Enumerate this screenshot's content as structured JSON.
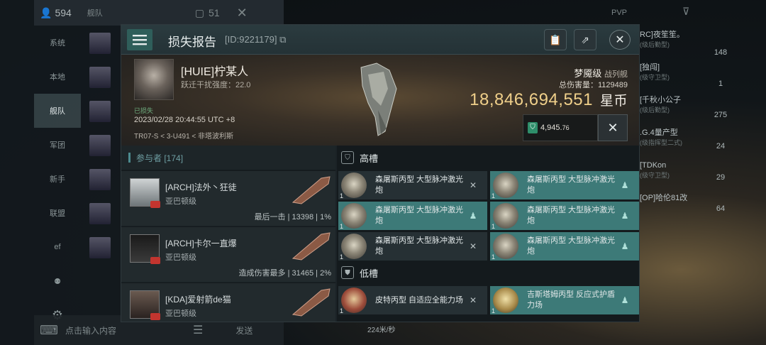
{
  "background_ui": {
    "left_top_count": "594",
    "chat_tab_label": "舰队",
    "chat_tab_count": "51",
    "side_nav": [
      "系统",
      "本地",
      "舰队",
      "军团",
      "新手",
      "联盟",
      "ef"
    ],
    "chat_placeholder": "点击输入内容",
    "send_label": "发送",
    "speed_text": "224米/秒",
    "top_right_label": "PVP",
    "right_column": [
      {
        "name": "RC]夜笙笙。",
        "sub": "(级后勤型)"
      },
      {
        "name": "[独闯]",
        "sub": "(级守卫型)"
      },
      {
        "name": "[千秋小公子",
        "sub": "(级后勤型)"
      },
      {
        "name": ".G.4量产型",
        "sub": "(级指挥型二式)"
      },
      {
        "name": "[TDKon",
        "sub": "(级守卫型)"
      },
      {
        "name": "[OP]哈伦81改",
        "sub": ""
      }
    ],
    "right_rail_counts": [
      "148",
      "1",
      "275",
      "24",
      "29",
      "64"
    ]
  },
  "header": {
    "title": "损失报告",
    "report_id": "[ID:9221179]",
    "copy_icon": "copy-icon",
    "clipboard_icon": "clipboard-icon",
    "share_icon": "share-icon",
    "close_icon": "close-icon"
  },
  "victim": {
    "name": "[HUIE]柠某人",
    "warp_disrupt": "跃迁干扰强度：22.0",
    "tag": "已损失",
    "datetime": "2023/02/28 20:44:55 UTC +8",
    "location": "TR07-S < 3-U491 < 非塔波利斯",
    "ship_name": "梦魇级",
    "ship_class": "战列舰",
    "damage_label": "总伤害量：1129489",
    "isk_value": "18,846,694,551",
    "isk_unit": "星币",
    "market_value": "4,945.",
    "market_value_decimal": "76",
    "fitting_icon": "wrench-icon"
  },
  "participants": {
    "title": "参与者 [174]",
    "rows": [
      {
        "name": "[ARCH]法外丶狂徒",
        "ship": "亚巴顿级",
        "stat": "最后一击 | 13398 | 1%"
      },
      {
        "name": "[ARCH]卡尔一直爆",
        "ship": "亚巴顿级",
        "stat": "造成伤害最多 | 31465 | 2%"
      },
      {
        "name": "[KDA]爱射箭de猫",
        "ship": "亚巴顿级",
        "stat": ""
      }
    ]
  },
  "slots": {
    "high_label": "高槽",
    "low_label": "低槽",
    "high": [
      {
        "text": "森屠斯丙型 大型脉冲激光炮",
        "qty": "1",
        "status": "destroyed",
        "highlight": false
      },
      {
        "text": "森屠斯丙型 大型脉冲激光炮",
        "qty": "1",
        "status": "dropped",
        "highlight": true
      },
      {
        "text": "森屠斯丙型 大型脉冲激光炮",
        "qty": "1",
        "status": "destroyed",
        "highlight": false
      },
      {
        "text": "森屠斯丙型 大型脉冲激光炮",
        "qty": "1",
        "status": "dropped",
        "highlight": false
      },
      {
        "text": "森屠斯丙型 大型脉冲激光炮",
        "qty": "1",
        "status": "dropped",
        "highlight": true
      },
      {
        "text": "森屠斯丙型 大型脉冲激光炮",
        "qty": "1",
        "status": "dropped",
        "highlight": true
      }
    ],
    "low": [
      {
        "text": "皮特丙型 自适应全能力场",
        "qty": "1",
        "status": "destroyed",
        "highlight": false
      },
      {
        "text": "吉斯塔姆丙型 反应式护盾力场",
        "qty": "1",
        "status": "dropped",
        "highlight": true
      }
    ]
  }
}
